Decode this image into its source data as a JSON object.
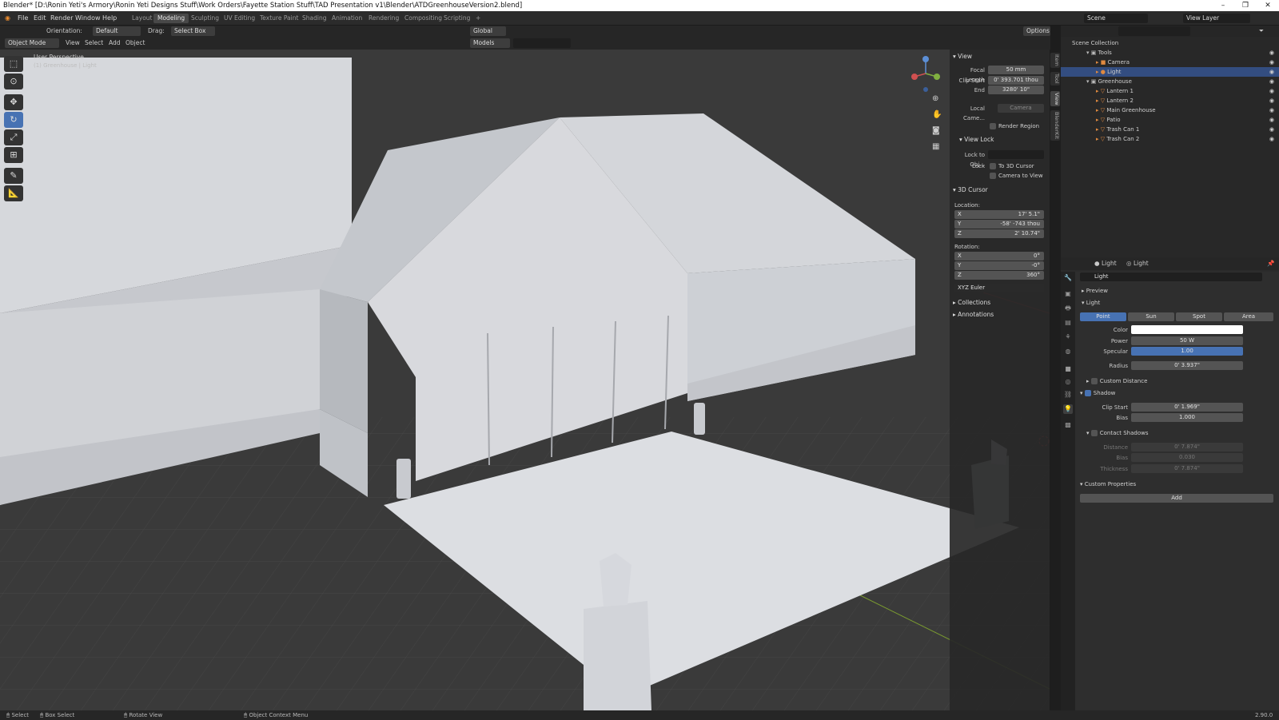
{
  "window": {
    "title": "Blender* [D:\\Ronin Yeti's Armory\\Ronin Yeti Designs Stuff\\Work Orders\\Fayette Station Stuff\\TAD Presentation v1\\Blender\\ATDGreenhouseVersion2.blend]",
    "minimize": "–",
    "maximize": "❐",
    "close": "✕"
  },
  "menu": {
    "items": [
      "File",
      "Edit",
      "Render",
      "Window",
      "Help"
    ],
    "workspaces": [
      "Layout",
      "Modeling",
      "Sculpting",
      "UV Editing",
      "Texture Paint",
      "Shading",
      "Animation",
      "Rendering",
      "Compositing",
      "Scripting"
    ],
    "active_workspace": "Modeling",
    "add_workspace": "+",
    "scene": "Scene",
    "view_layer": "View Layer"
  },
  "tool_header": {
    "orientation_label": "Orientation:",
    "orientation_value": "Default",
    "drag_label": "Drag:",
    "drag_value": "Select Box",
    "transform_orientation": "Global",
    "options": "Options"
  },
  "viewport_header": {
    "mode": "Object Mode",
    "menus": [
      "View",
      "Select",
      "Add",
      "Object"
    ],
    "collection_filter": "Models"
  },
  "viewport": {
    "overlay_title": "User Perspective",
    "overlay_subtitle": "(1) Greenhouse | Light",
    "colors": {
      "grid_bg": "#3a3a3a",
      "floor": "#d2d4d8",
      "building": "#c9cbd0",
      "x_axis": "#a33a3a",
      "y_axis": "#7a9a30"
    }
  },
  "npanel": {
    "view_section": "View",
    "focal_length_label": "Focal Length",
    "focal_length": "50 mm",
    "clip_start_label": "Clip Start",
    "clip_start": "0' 393.701 thou",
    "end_label": "End",
    "end": "3280' 10\"",
    "local_camera_label": "Local Came...",
    "local_camera_value": "Camera",
    "render_region": "Render Region",
    "view_lock_section": "View Lock",
    "lock_to_obj_label": "Lock to Obj...",
    "lock_label": "Lock",
    "to_3d_cursor": "To 3D Cursor",
    "camera_to_view": "Camera to View",
    "cursor_section": "3D Cursor",
    "location_label": "Location:",
    "loc_x_label": "X",
    "loc_x": "17' 5.1\"",
    "loc_y_label": "Y",
    "loc_y": "-58' -743 thou",
    "loc_z_label": "Z",
    "loc_z": "2' 10.74\"",
    "rotation_label": "Rotation:",
    "rot_x_label": "X",
    "rot_x": "0°",
    "rot_y_label": "Y",
    "rot_y": "-0°",
    "rot_z_label": "Z",
    "rot_z": "360°",
    "rotation_mode": "XYZ Euler",
    "collections": "Collections",
    "annotations": "Annotations",
    "tabs": [
      "Item",
      "Tool",
      "View",
      "BlenderKit"
    ]
  },
  "outliner": {
    "root": "Scene Collection",
    "rows": [
      {
        "label": "Tools",
        "depth": 1
      },
      {
        "label": "Camera",
        "depth": 2
      },
      {
        "label": "Light",
        "depth": 2,
        "selected": true
      },
      {
        "label": "Greenhouse",
        "depth": 1
      },
      {
        "label": "Lantern 1",
        "depth": 2
      },
      {
        "label": "Lantern 2",
        "depth": 2
      },
      {
        "label": "Main Greenhouse",
        "depth": 2
      },
      {
        "label": "Patio",
        "depth": 2
      },
      {
        "label": "Trash Can 1",
        "depth": 2
      },
      {
        "label": "Trash Can 2",
        "depth": 2
      }
    ]
  },
  "properties": {
    "breadcrumb_obj": "Light",
    "breadcrumb_data": "Light",
    "datablock": "Light",
    "preview": "Preview",
    "light_section": "Light",
    "light_types": [
      "Point",
      "Sun",
      "Spot",
      "Area"
    ],
    "active_type": "Point",
    "color_label": "Color",
    "color_value": "#ffffff",
    "power_label": "Power",
    "power": "50 W",
    "specular_label": "Specular",
    "specular": "1.00",
    "radius_label": "Radius",
    "radius": "0' 3.937\"",
    "custom_distance": "Custom Distance",
    "shadow": "Shadow",
    "clip_start_label": "Clip Start",
    "clip_start": "0' 1.969\"",
    "bias_label": "Bias",
    "bias": "1.000",
    "contact_shadows": "Contact Shadows",
    "cs_distance_label": "Distance",
    "cs_distance": "0' 7.874\"",
    "cs_bias_label": "Bias",
    "cs_bias": "0.030",
    "cs_thickness_label": "Thickness",
    "cs_thickness": "0' 7.874\"",
    "custom_properties": "Custom Properties",
    "add": "Add"
  },
  "status": {
    "select": "Select",
    "box_select": "Box Select",
    "rotate_view": "Rotate View",
    "context_menu": "Object Context Menu",
    "version": "2.90.0"
  }
}
